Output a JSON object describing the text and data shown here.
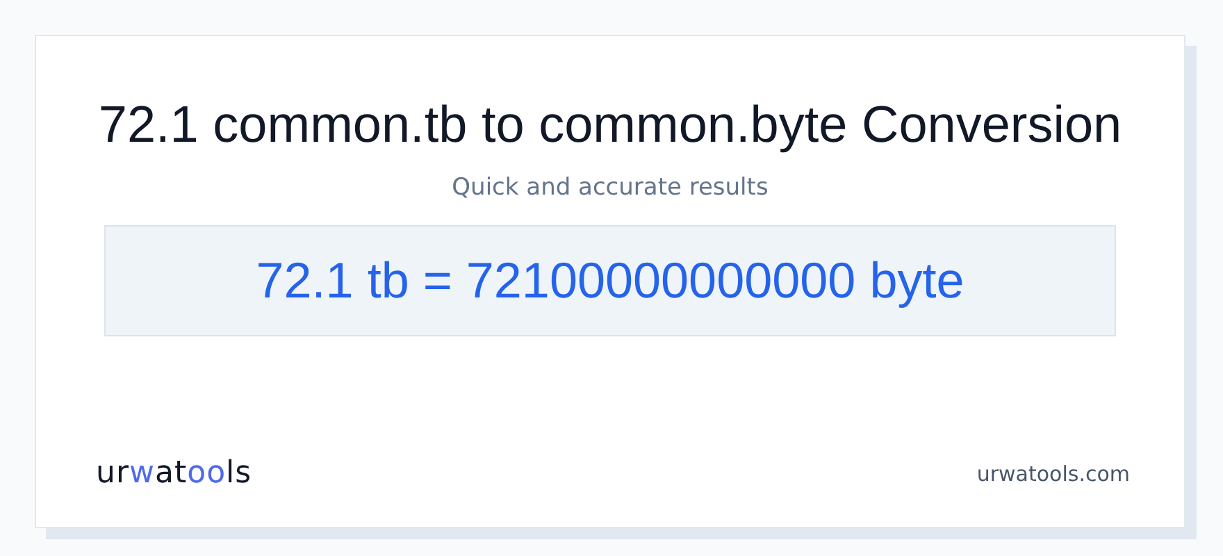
{
  "title": "72.1 common.tb to common.byte Conversion",
  "subtitle": "Quick and accurate results",
  "result": "72.1 tb = 72100000000000 byte",
  "footer": {
    "logo": [
      {
        "text": "ur",
        "accent": false
      },
      {
        "text": "w",
        "accent": true
      },
      {
        "text": "at",
        "accent": false
      },
      {
        "text": "oo",
        "accent": true
      },
      {
        "text": "ls",
        "accent": false
      }
    ],
    "site": "urwatools.com"
  }
}
